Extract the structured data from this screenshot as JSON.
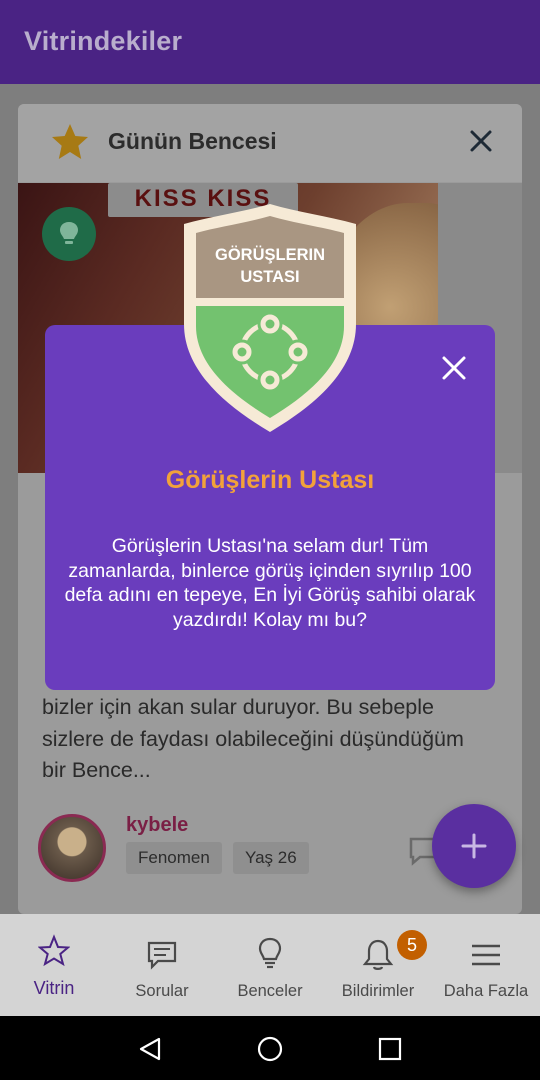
{
  "appbar": {
    "title": "Vitrindekiler"
  },
  "card": {
    "title": "Günün Bencesi",
    "image_sign_text": "KISS KISS",
    "excerpt_lines": [
      "bizler için akan sular duruyor. Bu sebeple",
      "sizlere de faydası olabileceğini düşündüğüm",
      "bir Bence..."
    ],
    "author": {
      "name": "kybele",
      "tags": [
        "Fenomen",
        "Yaş 26"
      ]
    }
  },
  "modal": {
    "badge_label_line1": "GÖRÜŞLERIN",
    "badge_label_line2": "USTASI",
    "title": "Görüşlerin Ustası",
    "body": "Görüşlerin Ustası'na selam dur! Tüm zamanlarda, binlerce görüş içinden sıyrılıp 100 defa adını en tepeye, En İyi Görüş sahibi olarak yazdırdı! Kolay mı bu?"
  },
  "bottom_nav": {
    "items": [
      {
        "label": "Vitrin",
        "icon": "star-outline-icon",
        "active": true
      },
      {
        "label": "Sorular",
        "icon": "chat-lines-icon"
      },
      {
        "label": "Benceler",
        "icon": "lightbulb-icon"
      },
      {
        "label": "Bildirimler",
        "icon": "bell-icon",
        "badge": "5"
      },
      {
        "label": "Daha Fazla",
        "icon": "hamburger-menu-icon"
      }
    ]
  },
  "colors": {
    "brand_purple": "#4a2384",
    "modal_purple": "#6a3dbd",
    "title_orange": "#f2a23a",
    "badge_orange": "#c25f00"
  }
}
